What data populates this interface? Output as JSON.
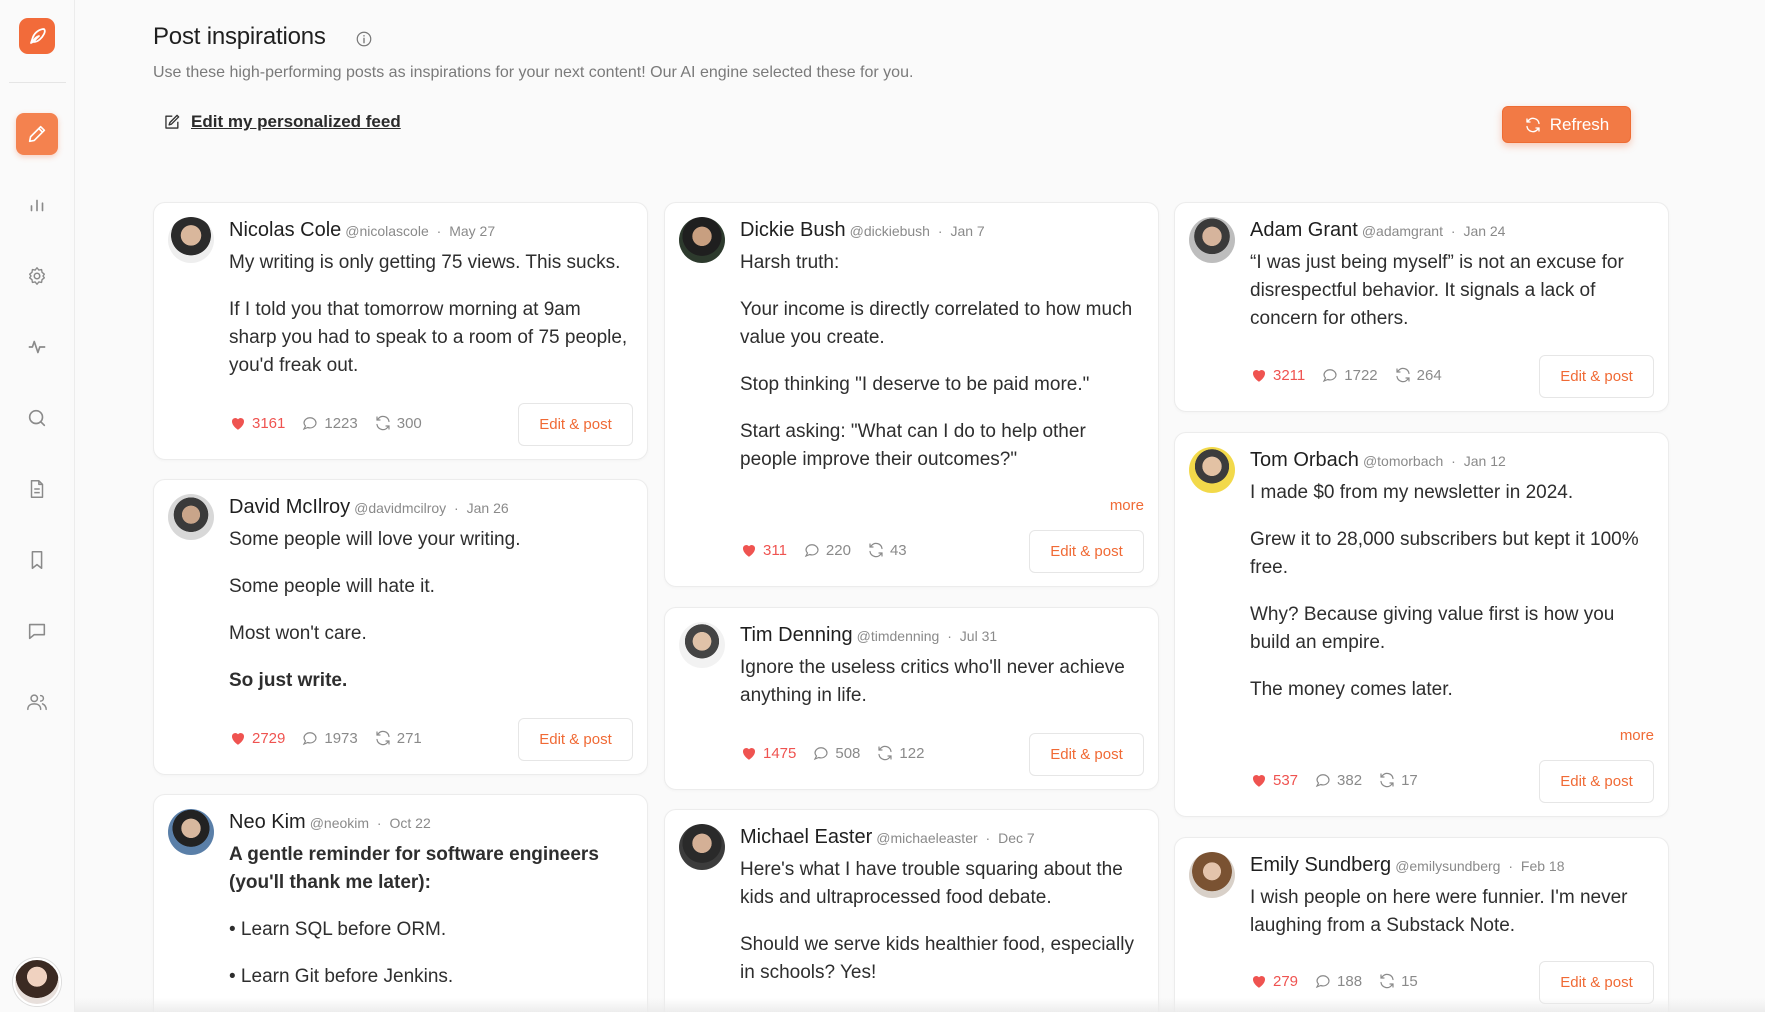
{
  "header": {
    "title": "Post inspirations",
    "subtitle": "Use these high-performing posts as inspirations for your next content! Our AI engine selected these for you.",
    "edit_feed_label": "Edit my personalized feed",
    "refresh_label": "Refresh"
  },
  "sidebar": {
    "items": [
      {
        "icon": "pencil-icon",
        "active": true
      },
      {
        "icon": "bar-chart-icon"
      },
      {
        "icon": "gear-icon"
      },
      {
        "icon": "activity-icon"
      },
      {
        "icon": "search-icon"
      },
      {
        "icon": "document-icon"
      },
      {
        "icon": "bookmark-icon"
      },
      {
        "icon": "chat-icon"
      },
      {
        "icon": "users-icon"
      }
    ]
  },
  "colors": {
    "accent": "#f27a45",
    "like": "#ef5350"
  },
  "posts": [
    {
      "name": "Nicolas Cole",
      "handle": "@nicolascole",
      "date": "May 27",
      "paragraphs": [
        "My writing is only getting 75 views. This sucks.",
        "If I told you that tomorrow morning at 9am sharp you had to speak to a room of 75 people, you'd freak out."
      ],
      "likes": "3161",
      "comments": "1223",
      "reposts": "300",
      "action": "Edit & post"
    },
    {
      "name": "David McIlroy",
      "handle": "@davidmcilroy",
      "date": "Jan 26",
      "paragraphs": [
        "Some people will love your writing.",
        "Some people will hate it.",
        "Most won't care.",
        "So just write."
      ],
      "likes": "2729",
      "comments": "1973",
      "reposts": "271",
      "action": "Edit & post"
    },
    {
      "name": "Neo Kim",
      "handle": "@neokim",
      "date": "Oct 22",
      "paragraphs": [
        "A gentle reminder for software engineers (you'll thank me later):",
        "• Learn SQL before ORM.",
        "• Learn Git before Jenkins."
      ]
    },
    {
      "name": "Dickie Bush",
      "handle": "@dickiebush",
      "date": "Jan 7",
      "paragraphs": [
        "Harsh truth:",
        "Your income is directly correlated to how much value you create.",
        "Stop thinking \"I deserve to be paid more.\"",
        "Start asking: \"What can I do to help other people improve their outcomes?\""
      ],
      "more": "more",
      "likes": "311",
      "comments": "220",
      "reposts": "43",
      "action": "Edit & post"
    },
    {
      "name": "Tim Denning",
      "handle": "@timdenning",
      "date": "Jul 31",
      "paragraphs": [
        "Ignore the useless critics who'll never achieve anything in life."
      ],
      "likes": "1475",
      "comments": "508",
      "reposts": "122",
      "action": "Edit & post"
    },
    {
      "name": "Michael Easter",
      "handle": "@michaeleaster",
      "date": "Dec 7",
      "paragraphs": [
        "Here's what I have trouble squaring about the kids and ultraprocessed food debate.",
        "Should we serve kids healthier food, especially in schools? Yes!"
      ]
    },
    {
      "name": "Adam Grant",
      "handle": "@adamgrant",
      "date": "Jan 24",
      "paragraphs": [
        "“I was just being myself” is not an excuse for disrespectful behavior. It signals a lack of concern for others."
      ],
      "likes": "3211",
      "comments": "1722",
      "reposts": "264",
      "action": "Edit & post"
    },
    {
      "name": "Tom Orbach",
      "handle": "@tomorbach",
      "date": "Jan 12",
      "paragraphs": [
        "I made $0 from my newsletter in 2024.",
        "Grew it to 28,000 subscribers but kept it 100% free.",
        "Why? Because giving value first is how you build an empire.",
        "The money comes later."
      ],
      "more": "more",
      "likes": "537",
      "comments": "382",
      "reposts": "17",
      "action": "Edit & post"
    },
    {
      "name": "Emily Sundberg",
      "handle": "@emilysundberg",
      "date": "Feb 18",
      "paragraphs": [
        "I wish people on here were funnier. I'm never laughing from a Substack Note."
      ],
      "likes": "279",
      "comments": "188",
      "reposts": "15",
      "action": "Edit & post"
    }
  ]
}
